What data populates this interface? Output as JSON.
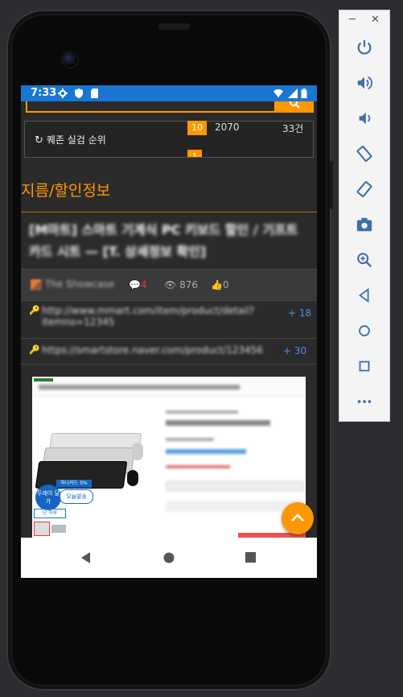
{
  "status_bar": {
    "time": "7:33"
  },
  "ranking": {
    "title": "퀘존 실검 순위",
    "rows": [
      {
        "num": "10",
        "term": "2070",
        "count": "33건"
      },
      {
        "num": "1",
        "term": "",
        "count": ""
      }
    ]
  },
  "section": {
    "title": "지름/할인정보"
  },
  "post": {
    "title_line1": "[M마트] 스마트 기계식 PC 키보드 할인 / 기프트",
    "title_line2": "카드 시트 — [T. 상세정보 확인]",
    "author": "The Showcase",
    "comments": "4",
    "views": "876",
    "likes": "0"
  },
  "links": [
    {
      "url": "http://www.mmart.com/item/product/detail?itemno=12345",
      "count": "+ 18"
    },
    {
      "url": "https://smartstore.naver.com/product/123456",
      "count": "+ 30"
    }
  ],
  "embedded": {
    "badge1": "두레이 딜가",
    "badge2": "오늘발송",
    "sticker": "하나카드 5%",
    "tab": "단 하루"
  },
  "colors": {
    "accent": "#ff9800",
    "statusbar": "#1976d2",
    "background": "#2b2b2b",
    "link_count": "#4a90e2",
    "comment_count": "#e53935"
  },
  "emulator_tools": [
    "power-icon",
    "volume-up-icon",
    "volume-down-icon",
    "rotate-left-icon",
    "rotate-right-icon",
    "camera-icon",
    "zoom-icon",
    "back-icon",
    "home-icon",
    "overview-icon",
    "more-icon"
  ]
}
